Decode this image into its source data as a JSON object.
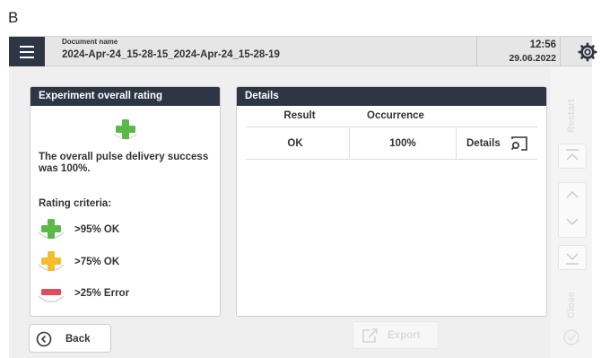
{
  "panel_letter": "B",
  "header": {
    "doc_label": "Document name",
    "doc_name": "2024-Apr-24_15-28-15_2024-Apr-24_15-28-19",
    "time": "12:56",
    "date": "29.06.2022"
  },
  "rating": {
    "title": "Experiment overall rating",
    "summary": "The overall pulse delivery success was 100%.",
    "criteria_title": "Rating criteria:",
    "criteria": [
      {
        "label": ">95% OK",
        "color": "#5ab947"
      },
      {
        "label": ">75% OK",
        "color": "#f5bc2c"
      },
      {
        "label": ">25% Error",
        "color": "#e34a5c"
      }
    ]
  },
  "details": {
    "title": "Details",
    "columns": [
      "Result",
      "Occurrence"
    ],
    "row": {
      "result": "OK",
      "occurrence": "100%",
      "button": "Details"
    }
  },
  "footer": {
    "back": "Back",
    "export": "Export"
  },
  "side": {
    "restart": "Restart",
    "close": "Close"
  },
  "colors": {
    "header_dark": "#2e3544",
    "ok_green": "#5ab947",
    "warn_yellow": "#f5bc2c",
    "error_red": "#e34a5c"
  }
}
